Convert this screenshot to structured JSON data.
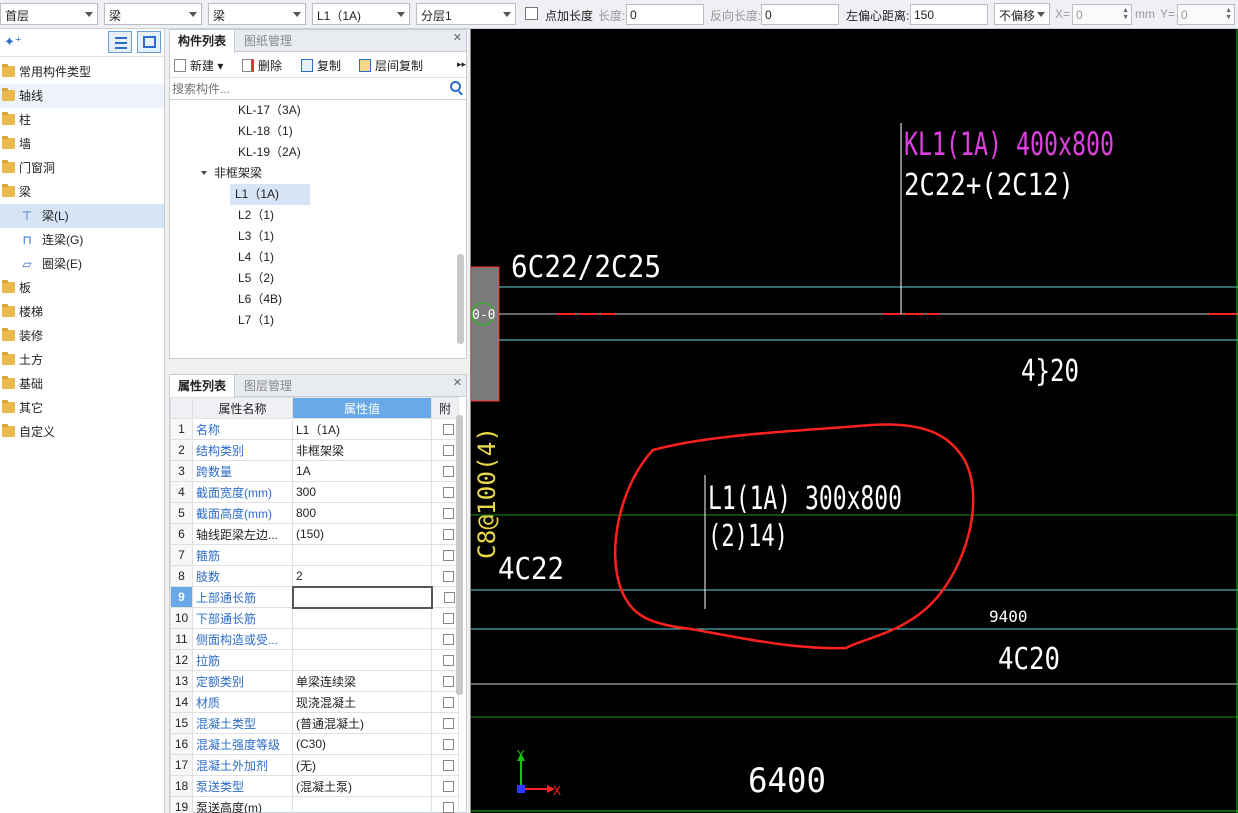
{
  "toolbar": {
    "floor": "首层",
    "category": "梁",
    "subcategory": "梁",
    "component": "L1（1A)",
    "layer": "分层1",
    "point_length_label": "点加长度",
    "length_label": "长度:",
    "length_value": "0",
    "reverse_length_label": "反向长度:",
    "reverse_length_value": "0",
    "left_offset_label": "左偏心距离:",
    "left_offset_value": "150",
    "offset_mode": "不偏移",
    "x_label": "X=",
    "x_value": "0",
    "unit": "mm",
    "y_label": "Y=",
    "y_value": "0"
  },
  "left_tree": {
    "items": [
      {
        "label": "常用构件类型"
      },
      {
        "label": "轴线"
      },
      {
        "label": "柱"
      },
      {
        "label": "墙"
      },
      {
        "label": "门窗洞"
      },
      {
        "label": "梁"
      },
      {
        "label": "梁(L)"
      },
      {
        "label": "连梁(G)"
      },
      {
        "label": "圈梁(E)"
      },
      {
        "label": "板"
      },
      {
        "label": "楼梯"
      },
      {
        "label": "装修"
      },
      {
        "label": "土方"
      },
      {
        "label": "基础"
      },
      {
        "label": "其它"
      },
      {
        "label": "自定义"
      }
    ]
  },
  "component_panel": {
    "tab_active": "构件列表",
    "tab_other": "图纸管理",
    "actions": {
      "new": "新建",
      "delete": "删除",
      "copy": "复制",
      "floor_copy": "层间复制"
    },
    "search_placeholder": "搜索构件...",
    "items": [
      "KL-17（3A)",
      "KL-18（1)",
      "KL-19（2A)"
    ],
    "group_label": "非框架梁",
    "group_items": [
      "L1（1A)",
      "L2（1)",
      "L3（1)",
      "L4（1)",
      "L5（2)",
      "L6（4B)",
      "L7（1)"
    ]
  },
  "property_panel": {
    "tab_active": "属性列表",
    "tab_other": "图层管理",
    "col_name": "属性名称",
    "col_value": "属性值",
    "col_extra": "附",
    "rows": [
      {
        "n": "1",
        "name": "名称",
        "value": "L1（1A)"
      },
      {
        "n": "2",
        "name": "结构类别",
        "value": "非框架梁"
      },
      {
        "n": "3",
        "name": "跨数量",
        "value": "1A"
      },
      {
        "n": "4",
        "name": "截面宽度(mm)",
        "value": "300"
      },
      {
        "n": "5",
        "name": "截面高度(mm)",
        "value": "800"
      },
      {
        "n": "6",
        "name": "轴线距梁左边...",
        "value": "(150)"
      },
      {
        "n": "7",
        "name": "箍筋",
        "value": ""
      },
      {
        "n": "8",
        "name": "肢数",
        "value": "2"
      },
      {
        "n": "9",
        "name": "上部通长筋",
        "value": ""
      },
      {
        "n": "10",
        "name": "下部通长筋",
        "value": ""
      },
      {
        "n": "11",
        "name": "侧面构造或受...",
        "value": ""
      },
      {
        "n": "12",
        "name": "拉筋",
        "value": ""
      },
      {
        "n": "13",
        "name": "定额类别",
        "value": "单梁连续梁"
      },
      {
        "n": "14",
        "name": "材质",
        "value": "现浇混凝土"
      },
      {
        "n": "15",
        "name": "混凝土类型",
        "value": "(普通混凝土)"
      },
      {
        "n": "16",
        "name": "混凝土强度等级",
        "value": "(C30)"
      },
      {
        "n": "17",
        "name": "混凝土外加剂",
        "value": "(无)"
      },
      {
        "n": "18",
        "name": "泵送类型",
        "value": "(混凝土泵)"
      },
      {
        "n": "19",
        "name": "泵送高度(m)",
        "value": ""
      }
    ]
  },
  "canvas": {
    "kl1_label": "KL1(1A) 400x800",
    "kl1_rebar": "2C22+(2C12)",
    "top_rebar": "6C22/2C25",
    "right_rebar_1": "4}20",
    "l1_label": "L1(1A) 300x800",
    "l1_stirrup": "(2)14)",
    "left_rebar": "4C22",
    "left_vertical": "C8@100(4)",
    "dim_9400": "9400",
    "right_rebar_2": "4C20",
    "dim_6400": "6400",
    "axis_x": "X",
    "axis_y": "Y",
    "column_mark": "0-0"
  },
  "colors": {
    "accent": "#2d6cc7",
    "selection": "#d6e4f5",
    "cad_cyan": "#5fd3d8",
    "cad_magenta": "#e040e0",
    "cad_green": "#19c219",
    "cad_red": "#ff2020",
    "cad_yellow": "#e8d84a"
  }
}
